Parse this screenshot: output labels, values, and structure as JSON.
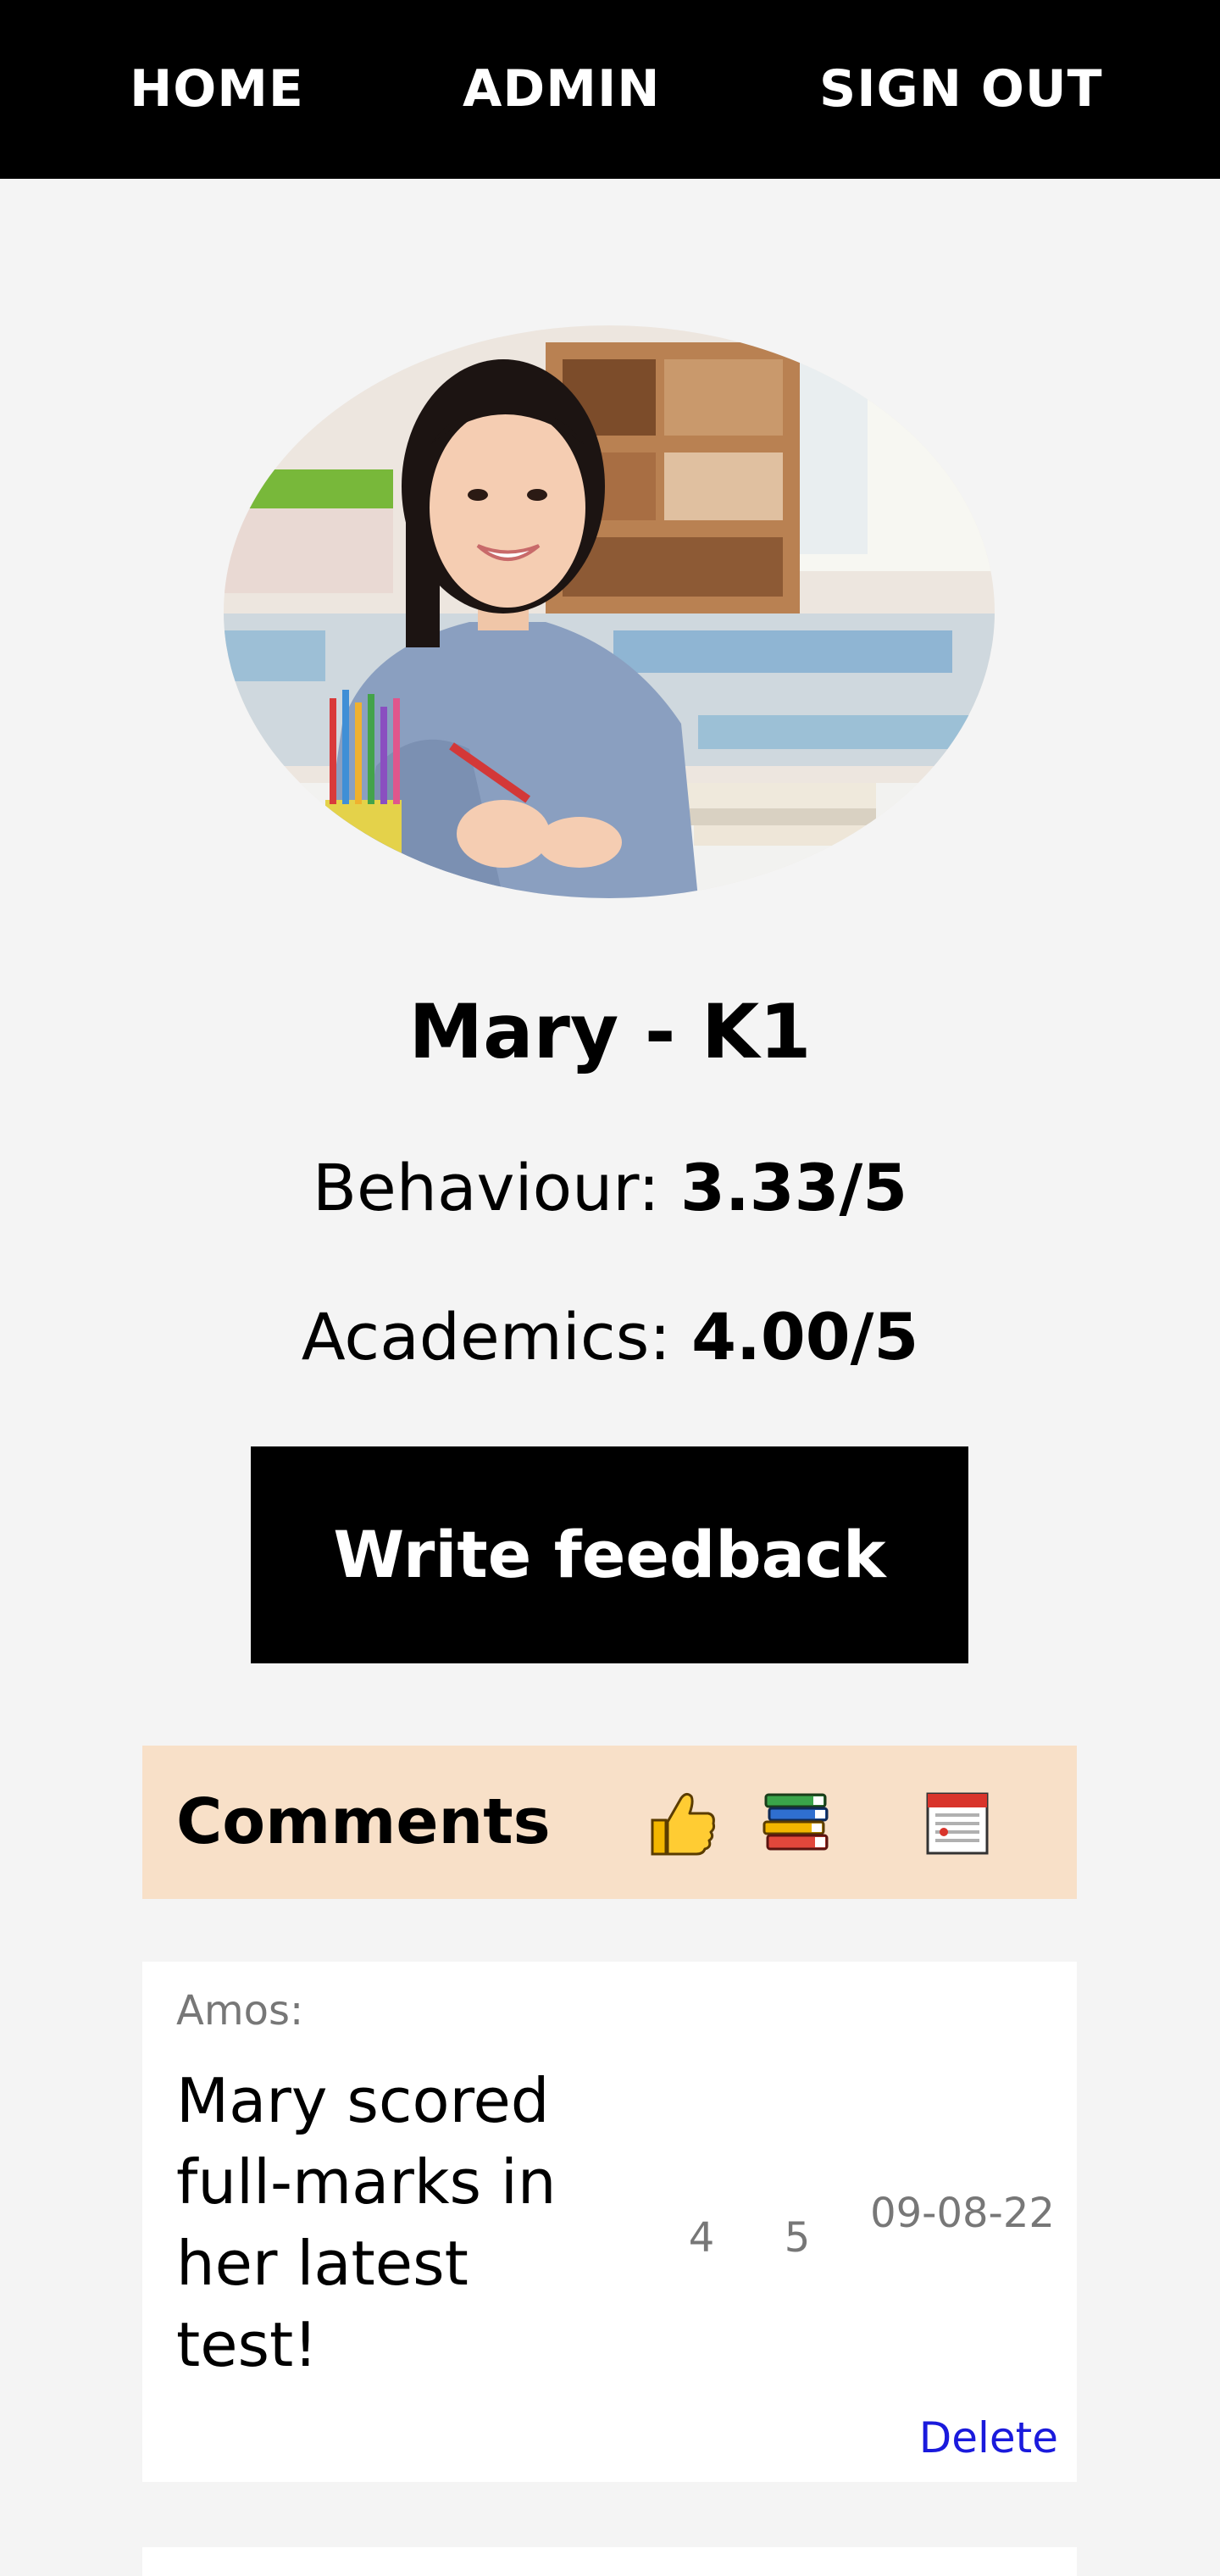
{
  "nav": {
    "home": "HOME",
    "admin": "ADMIN",
    "sign_out": "SIGN OUT"
  },
  "profile": {
    "name": "Mary - K1",
    "behaviour_label": "Behaviour:",
    "behaviour_score": "3.33/5",
    "academics_label": "Academics:",
    "academics_score": "4.00/5"
  },
  "actions": {
    "write_feedback": "Write feedback"
  },
  "comments": {
    "title": "Comments",
    "column_icons": [
      "thumbs-up-icon",
      "books-icon",
      "calendar-icon"
    ],
    "items": [
      {
        "author": "Amos:",
        "text": "Mary scored full-marks in her latest test!",
        "behaviour": "4",
        "academics": "5",
        "date": "09-08-22",
        "delete_label": "Delete"
      }
    ]
  },
  "colors": {
    "nav_bg": "#000000",
    "page_bg": "#f4f4f4",
    "comments_header_bg": "#f8e0c8",
    "delete_link": "#1a1adc"
  }
}
